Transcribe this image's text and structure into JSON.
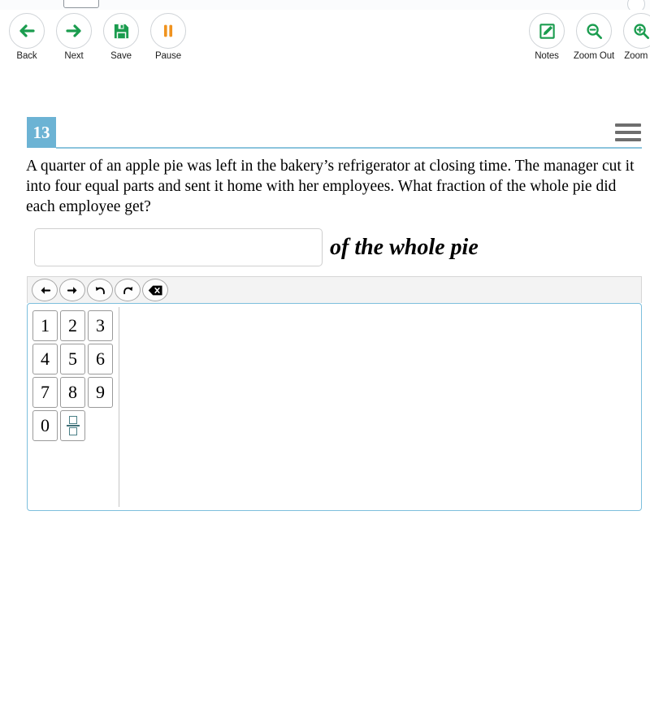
{
  "app": {
    "top_strip_fragment": "",
    "background_color": "#ffffff"
  },
  "toolbar": {
    "accent_green": "#1a9c4e",
    "accent_orange": "#f0931f",
    "left_buttons": [
      {
        "label": "Back",
        "icon": "arrow-left-icon"
      },
      {
        "label": "Next",
        "icon": "arrow-right-icon"
      },
      {
        "label": "Save",
        "icon": "floppy-disk-icon"
      },
      {
        "label": "Pause",
        "icon": "pause-icon"
      }
    ],
    "right_buttons": [
      {
        "label": "Notes",
        "icon": "pencil-square-icon"
      },
      {
        "label": "Zoom Out",
        "icon": "magnifier-minus-icon"
      },
      {
        "label": "Zoom In",
        "icon": "magnifier-plus-icon"
      }
    ]
  },
  "question": {
    "number": "13",
    "badge_color": "#6cb3d4",
    "rule_color": "#8cc5dd",
    "menu_icon": "hamburger-menu-icon",
    "text": "A quarter of an apple pie was left in the bakery’s refrigerator at closing time. The manager cut it into four equal parts and sent it home with her employees. What fraction of the whole pie did each employee get?"
  },
  "answer": {
    "value": "",
    "placeholder": "",
    "suffix": "of the whole pie"
  },
  "keypad": {
    "panel_border_color": "#7dbfdd",
    "toolbar_buttons": [
      {
        "name": "move-left-button",
        "icon": "arrow-left-icon",
        "glyph": "←"
      },
      {
        "name": "move-right-button",
        "icon": "arrow-right-icon",
        "glyph": "→"
      },
      {
        "name": "undo-button",
        "icon": "undo-arrow-icon",
        "glyph": "↶"
      },
      {
        "name": "redo-button",
        "icon": "redo-arrow-icon",
        "glyph": "↷"
      },
      {
        "name": "backspace-button",
        "icon": "backspace-icon",
        "glyph": "⌫"
      }
    ],
    "keys": [
      {
        "label": "1",
        "name": "key-1"
      },
      {
        "label": "2",
        "name": "key-2"
      },
      {
        "label": "3",
        "name": "key-3"
      },
      {
        "label": "4",
        "name": "key-4"
      },
      {
        "label": "5",
        "name": "key-5"
      },
      {
        "label": "6",
        "name": "key-6"
      },
      {
        "label": "7",
        "name": "key-7"
      },
      {
        "label": "8",
        "name": "key-8"
      },
      {
        "label": "9",
        "name": "key-9"
      },
      {
        "label": "0",
        "name": "key-0"
      },
      {
        "label": "",
        "name": "key-fraction",
        "icon": "fraction-icon"
      }
    ]
  }
}
